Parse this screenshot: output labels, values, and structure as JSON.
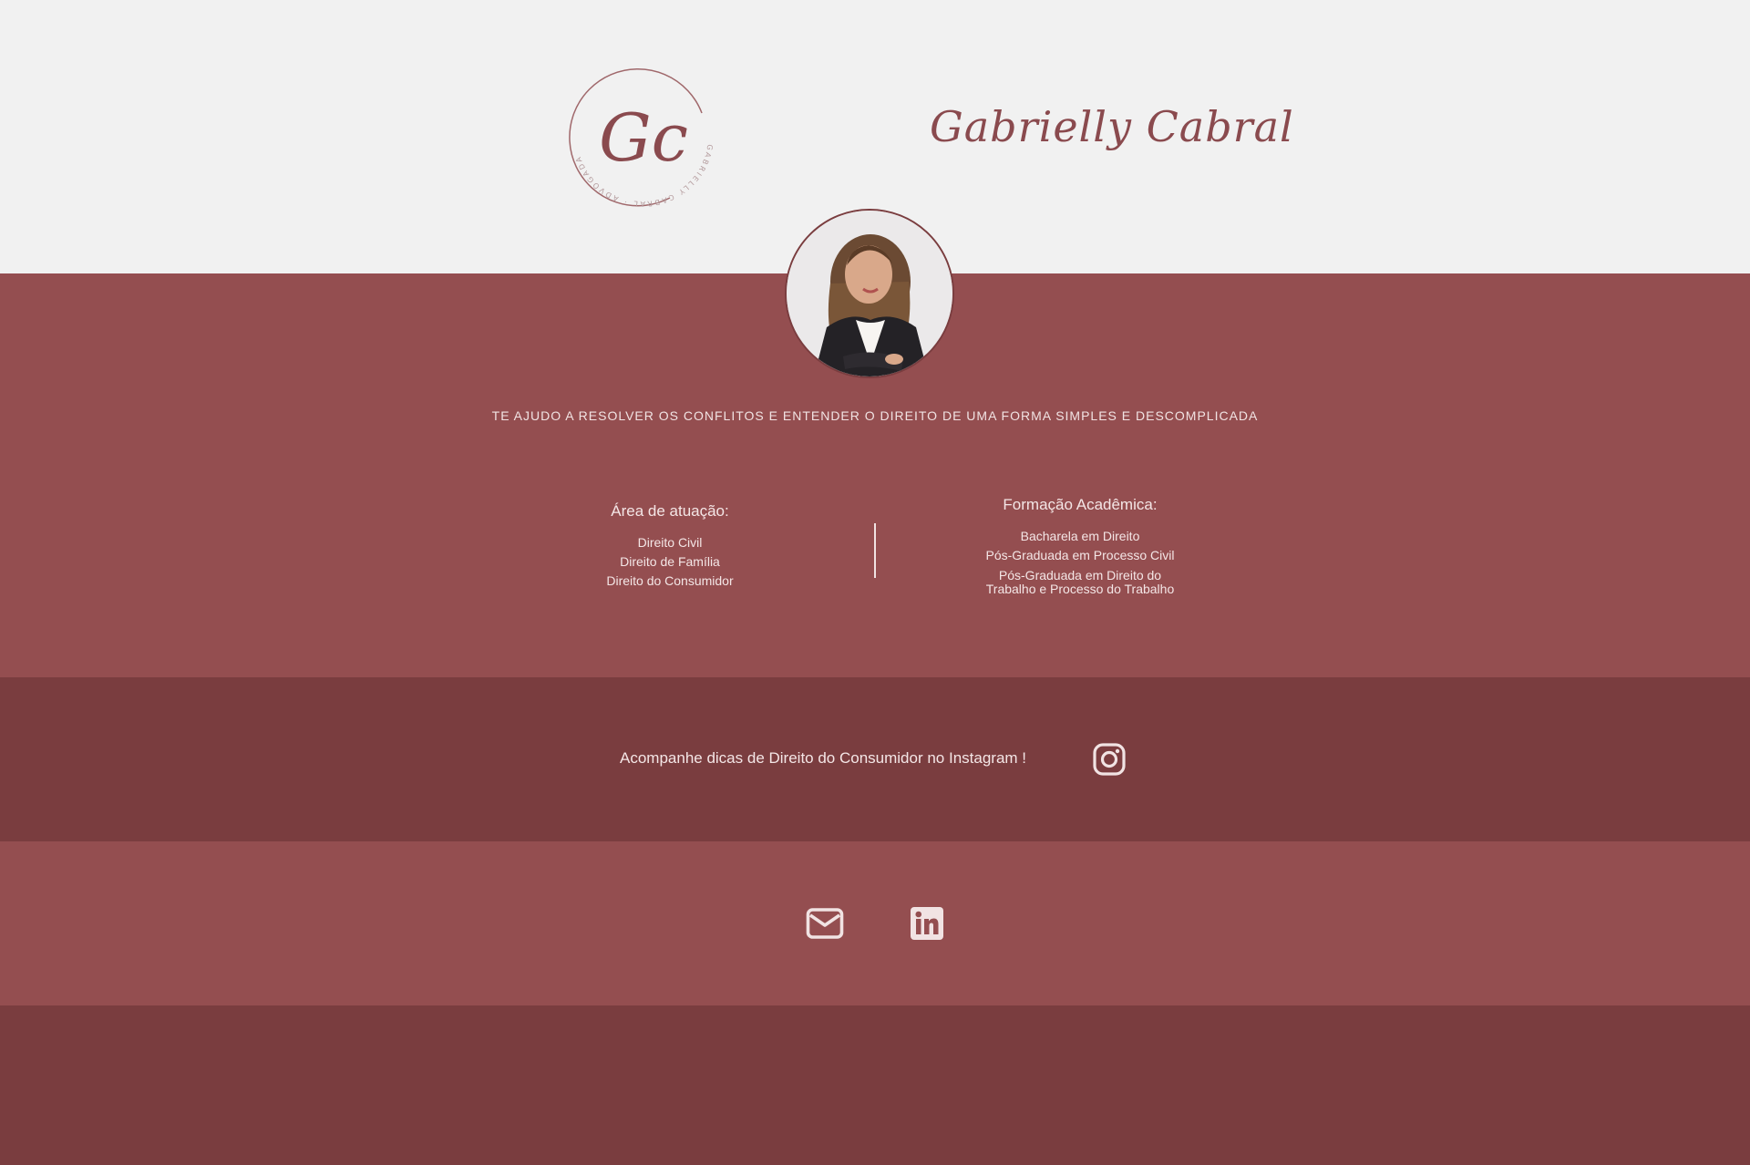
{
  "logo": {
    "monogram": "Gc",
    "ring_text": "GABRIELLY CABRAL · ADVOGADA",
    "icon": "gc-monogram-logo"
  },
  "brand": {
    "name": "Gabrielly Cabral"
  },
  "hero": {
    "tagline": "TE AJUDO A RESOLVER OS CONFLITOS E ENTENDER O DIREITO DE UMA FORMA SIMPLES E DESCOMPLICADA",
    "areas": {
      "title": "Área de atuação:",
      "items": [
        "Direito Civil",
        "Direito de Família",
        "Direito do Consumidor"
      ]
    },
    "education": {
      "title": "Formação Acadêmica:",
      "items": [
        "Bacharela em Direito",
        "Pós-Graduada em Processo Civil",
        "Pós-Graduada em Direito do",
        "Trabalho e Processo do Trabalho"
      ]
    }
  },
  "instagram": {
    "text": "Acompanhe dicas de Direito do Consumidor no Instagram !",
    "icon": "instagram-icon"
  },
  "contact": {
    "email_icon": "envelope-icon",
    "linkedin_icon": "linkedin-icon"
  },
  "colors": {
    "header_bg": "#f1f1f1",
    "rose": "#944e50",
    "wine": "#7a3d3f",
    "text_light": "#f4e6e6"
  }
}
